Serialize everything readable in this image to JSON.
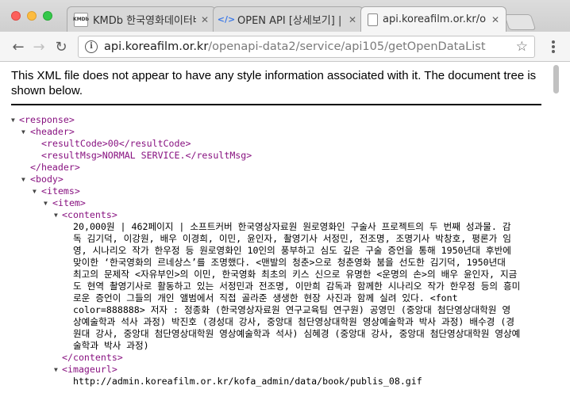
{
  "browser": {
    "tabs": [
      {
        "title": "KMDb 한국영화데이터베이",
        "favicon": "kmdb-logo",
        "active": false
      },
      {
        "title": "OPEN API [상세보기] | 게",
        "favicon": "code-icon",
        "active": false
      },
      {
        "title": "api.koreafilm.or.kr/oper",
        "favicon": "page-icon",
        "active": true
      }
    ],
    "url_host": "api.koreafilm.or.kr",
    "url_path": "/openapi-data2/service/api105/getOpenDataList"
  },
  "notice": "This XML file does not appear to have any style information associated with it. The document tree is shown below.",
  "xml": {
    "response_open": "<response>",
    "header_open": "<header>",
    "result_code_line": "<resultCode>00</resultCode>",
    "result_msg_line": "<resultMsg>NORMAL SERVICE.</resultMsg>",
    "header_close": "</header>",
    "body_open": "<body>",
    "items_open": "<items>",
    "item_open": "<item>",
    "contents_open": "<contents>",
    "contents_lines": [
      "20,000원 | 462페이지 | 소프트커버 한국영상자료원 원로영화인 구술사 프로젝트의 두 번째 성과물. 감",
      "독 김기덕, 이강원, 배우 이경희, 이민, 윤인자, 촬영기사 서정민, 전조명, 조명기사 박창호, 평론가 임",
      "영, 시나리오 작가 한우정 등 원로영화인 10인의 풍부하고 심도 깊은 구술 증언을 통해 1950년대 후반에",
      "맞이한 ‘한국영화의 르네상스’를 조명했다. <맨발의 청춘>으로 청춘영화 붐을 선도한 김기덕, 1950년대",
      "최고의 문제작 <자유부인>의 이민, 한국영화 최초의 키스 신으로 유명한 <운명의 손>의 배우 윤인자, 지금",
      "도 현역 촬영기사로 활동하고 있는 서정민과 전조명, 이만희 감독과 함께한 시나리오 작가 한우정 등의 흥미",
      "로운 증언이 그들의 개인 앨범에서 직접 골라준 생생한 현장 사진과 함께 실려 있다. <font",
      "color=888888> 저자 : 정종화 (한국영상자료원 연구교육팀 연구원) 공영민 (중앙대 첨단영상대학원 영",
      "상예술학과 석사 과정) 박진호 (경성대 강사, 중앙대 첨단영상대학원 영상예술학과 박사 과정) 배수경 (경",
      "원대 강사, 중앙대 첨단영상대학원 영상예술학과 석사) 심혜경 (중앙대 강사, 중앙대 첨단영상대학원 영상예",
      "술학과 박사 과정)"
    ],
    "contents_close": "</contents>",
    "imageurl_open": "<imageurl>",
    "imageurl_peek": "http://admin.koreafilm.or.kr/kofa_admin/data/book/publis_08.gif"
  },
  "colors": {
    "tag": "#881280",
    "text": "#000000",
    "tab_active": "#f5f5f5",
    "titlebar": "#d4d4d4"
  }
}
